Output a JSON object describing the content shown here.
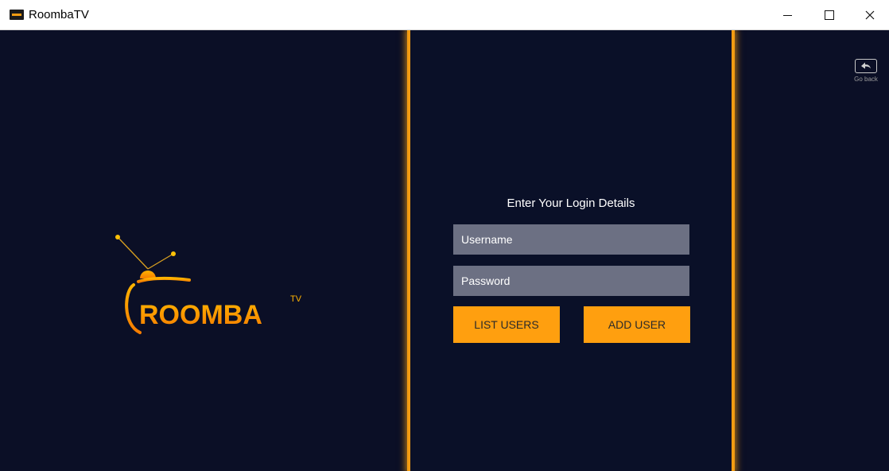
{
  "window": {
    "title": "RoombaTV"
  },
  "brand": {
    "name": "ROOMBA",
    "superscript": "TV",
    "accent": "#f39c12"
  },
  "login": {
    "title": "Enter Your Login Details",
    "username_placeholder": "Username",
    "password_placeholder": "Password",
    "list_users_label": "LIST USERS",
    "add_user_label": "ADD USER"
  },
  "nav": {
    "go_back_label": "Go back"
  },
  "colors": {
    "background": "#0b0f26",
    "panel_border": "#f39c12",
    "button": "#ff9f0f",
    "input": "#6c7083"
  }
}
